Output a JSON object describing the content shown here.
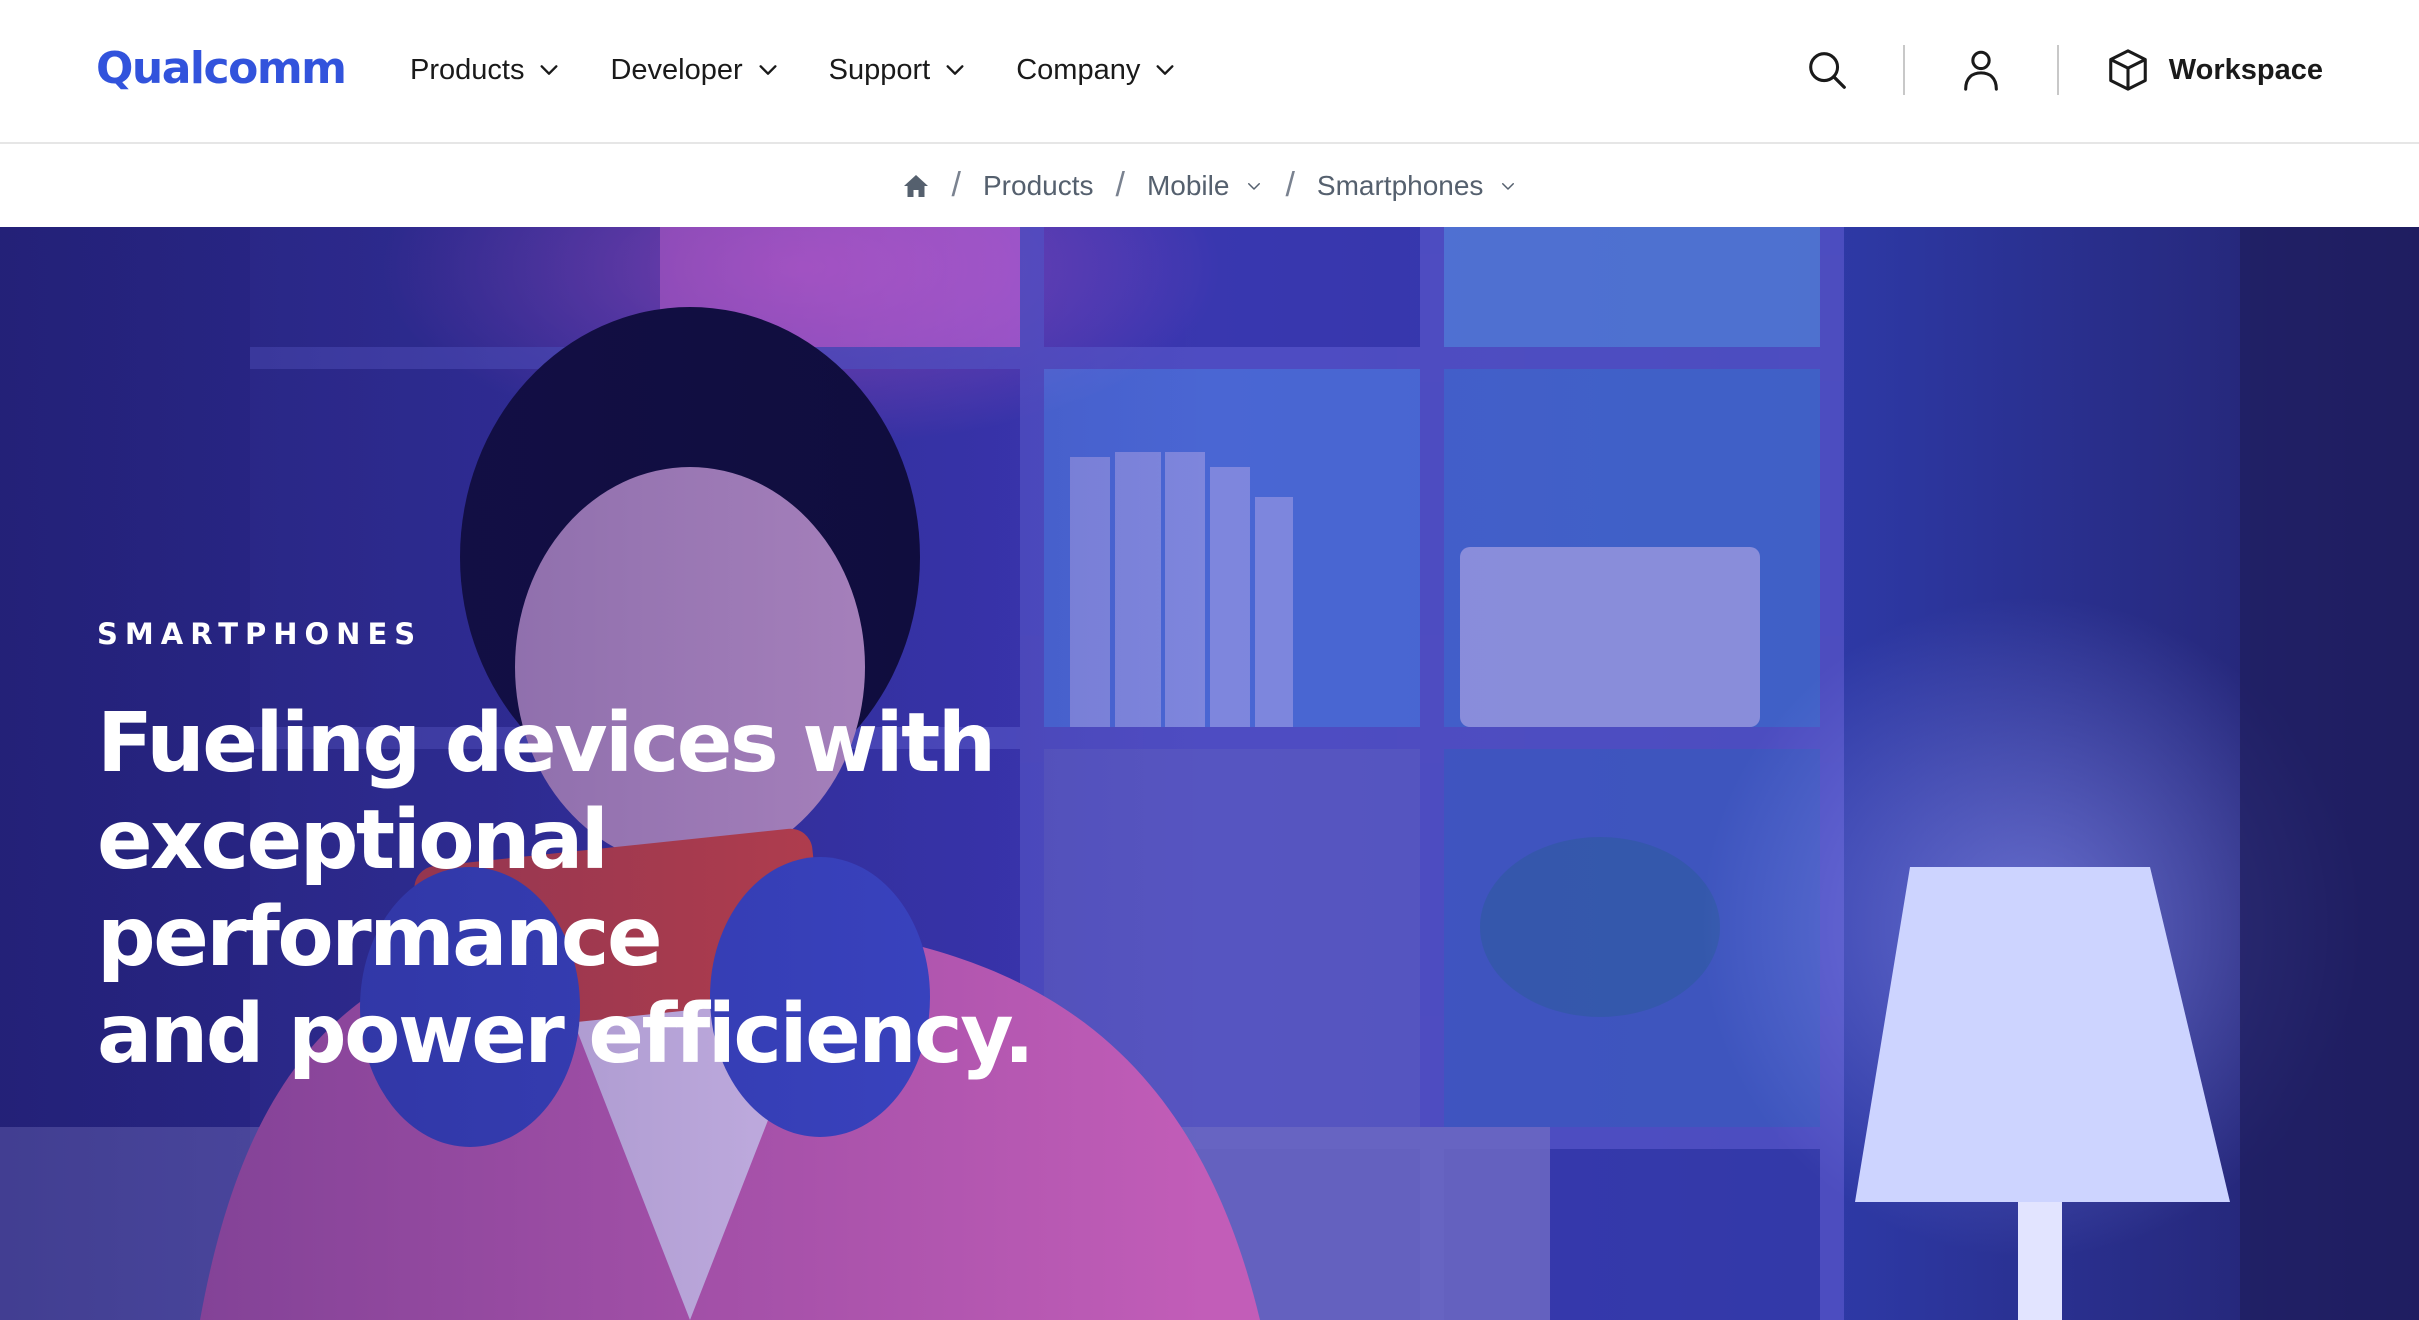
{
  "brand": {
    "name": "Qualcomm",
    "color": "#3253dc"
  },
  "nav": {
    "items": [
      {
        "label": "Products",
        "icon": "chevron-down-icon"
      },
      {
        "label": "Developer",
        "icon": "chevron-down-icon"
      },
      {
        "label": "Support",
        "icon": "chevron-down-icon"
      },
      {
        "label": "Company",
        "icon": "chevron-down-icon"
      }
    ],
    "right": {
      "search_icon": "search-icon",
      "account_icon": "user-icon",
      "workspace_label": "Workspace",
      "workspace_icon": "cube-icon"
    }
  },
  "breadcrumb": {
    "home_icon": "home-icon",
    "items": [
      {
        "label": "Products",
        "has_dropdown": false
      },
      {
        "label": "Mobile",
        "has_dropdown": true
      },
      {
        "label": "Smartphones",
        "has_dropdown": true
      }
    ],
    "separator": "/"
  },
  "hero": {
    "eyebrow": "SMARTPHONES",
    "headline_lines": [
      "Fueling devices with",
      "exceptional performance",
      "and power efficiency."
    ]
  },
  "colors": {
    "text_dark": "#1a1a1a",
    "breadcrumb_text": "#55606e",
    "hero_overlay": "#3a2fb8"
  }
}
